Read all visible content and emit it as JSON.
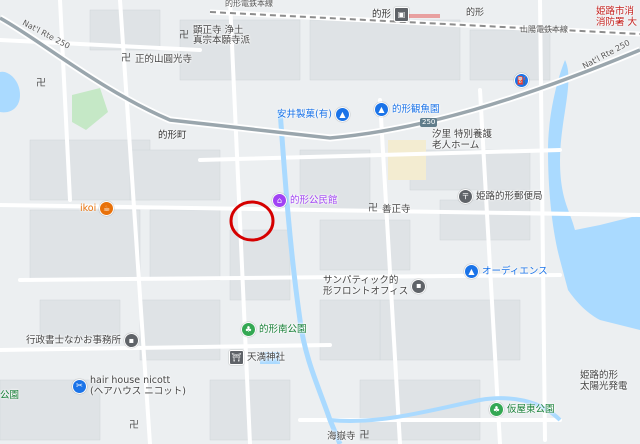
{
  "colors": {
    "water": "#aadaff",
    "park": "#c5e8c6",
    "road": "#ffffff",
    "highway": "#9aa6ad",
    "railway": "#8d8d8d",
    "temple_pin": "#5f6368",
    "shop_pin": "#1a73e8",
    "community_pin": "#a142f4",
    "cafe_pin": "#e8710a",
    "park_pin": "#34a853",
    "marker": "#d50000"
  },
  "roads": {
    "natl_rte_250_left": "Nat'l Rte 250",
    "natl_rte_250_right": "Nat'l Rte 250",
    "railway_top": "山陽電鉄本線",
    "railway_right": "山陽電鉄本線",
    "route_shield": "250"
  },
  "station": {
    "name": "的形",
    "icon": "train-station-icon"
  },
  "places": {
    "temple_1": "顕正寺 浄土",
    "temple_1b": "真宗本願寺派",
    "temple_2": "正的山圓光寺",
    "town": "的形町",
    "yasui": "安井製菓(有)",
    "kankou": "的形観魚園",
    "nursing_1": "汐里 特別養護",
    "nursing_2": "老人ホーム",
    "community": "的形公民館",
    "zensho": "善正寺",
    "post": "姫路的形郵便局",
    "ikoi": "ikoi",
    "audience": "オーディエンス",
    "sympathetic_1": "サンパティック的",
    "sympathetic_2": "形フロントオフィス",
    "park_south": "的形南公園",
    "tenman": "天満神社",
    "office": "行政書士なかお事務所",
    "hair_1": "hair house nicott",
    "hair_2": "(ヘアハウス ニコット)",
    "left_park": "公園",
    "kaiganji": "海嶽寺",
    "kariya_park": "仮屋東公園",
    "fire_1": "姫路市消",
    "fire_2": "消防署 大",
    "solar_1": "姫路的形",
    "solar_2": "太陽光発電",
    "top_left_text": "的形電鉄本線",
    "top_right_char": "的形"
  }
}
